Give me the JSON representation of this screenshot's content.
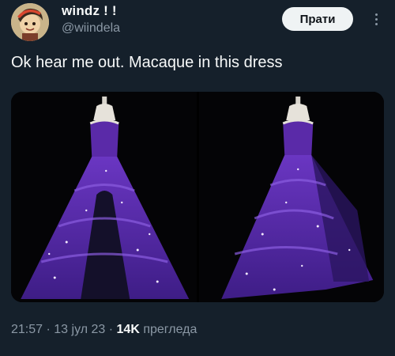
{
  "author": {
    "display_name": "windz ! !",
    "handle": "@wiindela"
  },
  "actions": {
    "follow_label": "Прати"
  },
  "tweet": {
    "text": "Ok hear me out. Macaque in this dress"
  },
  "media": {
    "images": [
      {
        "icon": "purple-gown-image-left"
      },
      {
        "icon": "purple-gown-image-right"
      }
    ]
  },
  "meta": {
    "time": "21:57",
    "sep1": " · ",
    "date": "13 јул 23",
    "sep2": " · ",
    "views_count": "14K",
    "views_label": " прегледа"
  },
  "colors": {
    "background": "#15202b",
    "dress": "#5b2fa8",
    "secondary_text": "#8b98a5"
  }
}
